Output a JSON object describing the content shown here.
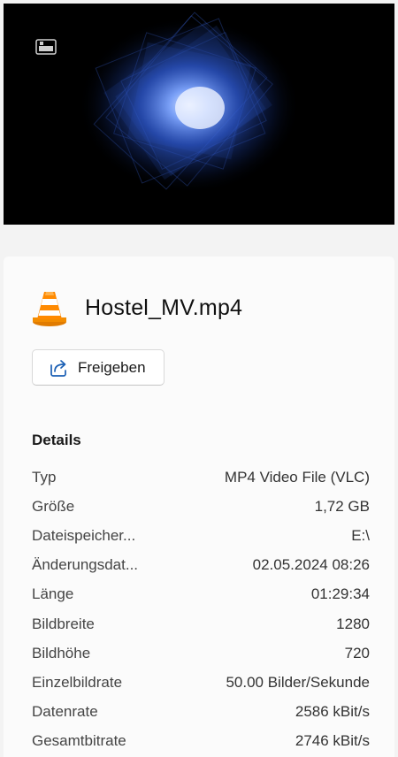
{
  "preview": {
    "accent": "#4a7dff",
    "overlay_icon": "tv-channel-logo-icon"
  },
  "file": {
    "name": "Hostel_MV.mp4",
    "app_icon": "vlc-cone-icon"
  },
  "share": {
    "label": "Freigeben",
    "icon": "share-arrow-icon"
  },
  "details": {
    "title": "Details",
    "rows": [
      {
        "label": "Typ",
        "value": "MP4 Video File (VLC)"
      },
      {
        "label": "Größe",
        "value": "1,72 GB"
      },
      {
        "label": "Dateispeicher...",
        "value": "E:\\"
      },
      {
        "label": "Änderungsdat...",
        "value": "02.05.2024 08:26"
      },
      {
        "label": "Länge",
        "value": "01:29:34"
      },
      {
        "label": "Bildbreite",
        "value": "1280"
      },
      {
        "label": "Bildhöhe",
        "value": "720"
      },
      {
        "label": "Einzelbildrate",
        "value": "50.00 Bilder/Sekunde"
      },
      {
        "label": "Datenrate",
        "value": "2586 kBit/s"
      },
      {
        "label": "Gesamtbitrate",
        "value": "2746 kBit/s"
      }
    ]
  }
}
